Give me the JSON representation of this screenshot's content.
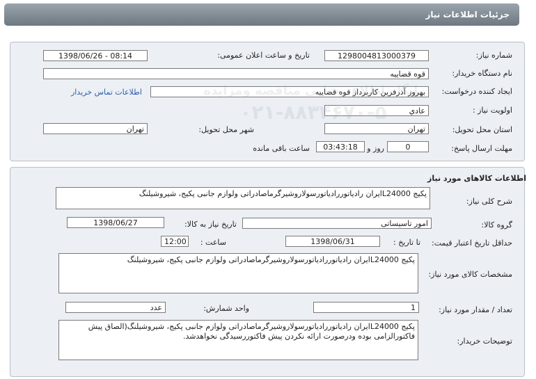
{
  "header": {
    "title": "جزئیات اطلاعات نیاز"
  },
  "info": {
    "need_number_label": "شماره نیاز:",
    "need_number": "1298004813000379",
    "announce_label": "تاریخ و ساعت اعلان عمومی:",
    "announce_value": "1398/06/26 - 08:14",
    "buyer_org_label": "نام دستگاه خریدار:",
    "buyer_org": "قوه قضاییه",
    "creator_label": "ایجاد کننده درخواست:",
    "creator": "بهروز آذرفرین کاربرداز قوه قضاییه",
    "contact_link": "اطلاعات تماس خریدار",
    "priority_label": "اولویت نیاز :",
    "priority": "عادي",
    "province_label": "استان محل تحویل:",
    "province": "تهران",
    "city_label": "شهر محل تحویل:",
    "city": "تهران",
    "deadline_label": "مهلت ارسال پاسخ:",
    "deadline_days": "0",
    "days_word": "روز و",
    "deadline_time": "03:43:18",
    "remaining_word": "ساعت باقی مانده"
  },
  "goods": {
    "title": "اطلاعات کالاهای مورد نیاز",
    "summary_label": "شرح کلی نیاز:",
    "summary": "پکیج L24000ایران رادیاتوررادیاتورسولاروشیرگرماصادراتی ولوازم جانبی پکیج، شیروشیلنگ",
    "group_label": "گروه کالا:",
    "group": "امور تاسیساتی",
    "need_date_label": "تاریخ نیاز به کالا:",
    "need_date": "1398/06/27",
    "validity_label": "حداقل تاریخ اعتبار قیمت:",
    "until_date_label": "تا تاریخ :",
    "until_date": "1398/06/31",
    "time_label": "ساعت :",
    "time": "12:00",
    "specs_label": "مشخصات کالای مورد نیاز:",
    "specs": "پکیج L24000ایران رادیاتوررادیاتورسولاروشیرگرماصادراتی ولوازم جانبی پکیج، شیروشیلنگ",
    "qty_label": "تعداد / مقدار مورد نیاز:",
    "qty": "1",
    "unit_label": "واحد شمارش:",
    "unit": "عدد",
    "buyer_notes_label": "توضیحات خریدار:",
    "buyer_notes": "پکیج L24000ایران رادیاتوررادیاتورسولاروشیرگرماصادراتی ولوازم جانبی پکیج، شیروشیلنگ(الصاق پیش فاکتورالزامی بوده ودرصورت ارائه نکردن پیش فاکتوررسیدگی نخواهدشد."
  },
  "watermark": {
    "line1": "پایگاه اطلاع رسانی مناقصه ومزایده",
    "line2": "۰۲۱-۸۸۳۴۶۷۰-۵"
  }
}
